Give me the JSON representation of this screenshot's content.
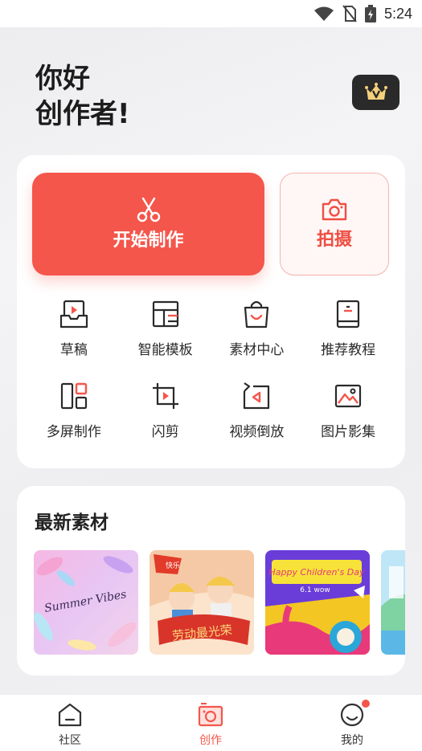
{
  "status_bar": {
    "time": "5:24"
  },
  "header": {
    "greeting_line1": "你好",
    "greeting_line2": "创作者!",
    "vip_icon": "crown-v-icon"
  },
  "actions": {
    "start": {
      "label": "开始制作",
      "icon": "scissors-icon"
    },
    "shoot": {
      "label": "拍摄",
      "icon": "camera-icon"
    }
  },
  "tools": [
    {
      "label": "草稿",
      "icon": "drafts-icon"
    },
    {
      "label": "智能模板",
      "icon": "template-icon"
    },
    {
      "label": "素材中心",
      "icon": "shopping-bag-icon"
    },
    {
      "label": "推荐教程",
      "icon": "book-icon"
    },
    {
      "label": "多屏制作",
      "icon": "multi-screen-icon"
    },
    {
      "label": "闪剪",
      "icon": "crop-play-icon"
    },
    {
      "label": "视频倒放",
      "icon": "reverse-play-icon"
    },
    {
      "label": "图片影集",
      "icon": "image-album-icon"
    }
  ],
  "materials": {
    "title": "最新素材",
    "items": [
      {
        "text": "Summer Vibes"
      },
      {
        "badge": "快乐",
        "text": "劳动最光荣"
      },
      {
        "text1": "Happy Children's Day",
        "text2": "6.1 wow"
      },
      {
        "text": ""
      }
    ]
  },
  "tab_bar": {
    "items": [
      {
        "label": "社区",
        "icon": "community-home-icon"
      },
      {
        "label": "创作",
        "icon": "create-camera-icon"
      },
      {
        "label": "我的",
        "icon": "profile-smile-icon"
      }
    ],
    "active_index": 1
  },
  "colors": {
    "accent": "#f4564b",
    "dark": "#2a2a2a"
  }
}
